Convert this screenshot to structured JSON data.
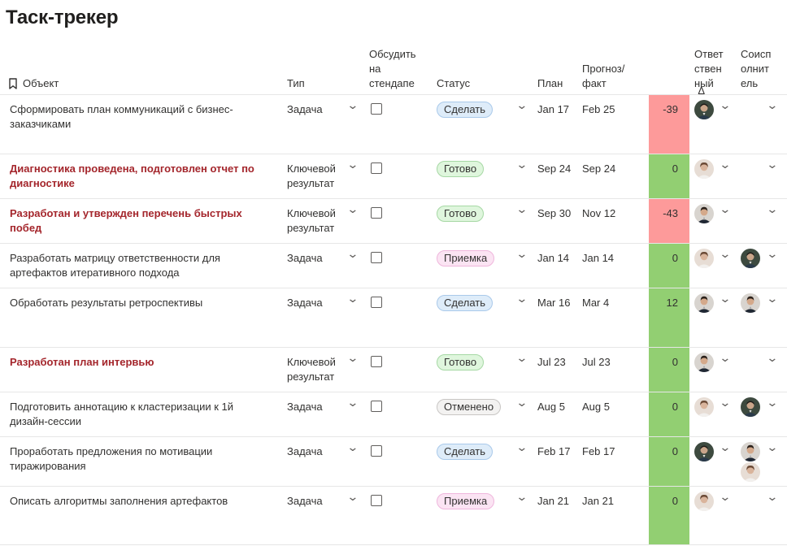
{
  "title": "Таск-трекер",
  "columns": {
    "object": "Объект",
    "type": "Тип",
    "discuss": [
      "Обсудить",
      "на",
      "стендапе"
    ],
    "status": "Статус",
    "plan": "План",
    "forecast": [
      "Прогноз/",
      "факт"
    ],
    "delta": "Δ",
    "responsible": [
      "Ответ",
      "ствен",
      "ный"
    ],
    "coexecutor": [
      "Соисп",
      "олнит",
      "ель"
    ]
  },
  "colors": {
    "negative_delta": "#fd9a9a",
    "positive_delta": "#92cf72",
    "key_result_text": "#a4262c"
  },
  "status_styles": {
    "Сделать": {
      "bg": "#deecf9",
      "border": "#a9c9ea",
      "text": "#323130"
    },
    "Готово": {
      "bg": "#dff6dd",
      "border": "#a6d8a4",
      "text": "#323130"
    },
    "Приемка": {
      "bg": "#fbe4f3",
      "border": "#efb6dc",
      "text": "#323130"
    },
    "Отменено": {
      "bg": "#f3f2f1",
      "border": "#c8c6c4",
      "text": "#323130"
    }
  },
  "rows": [
    {
      "name": [
        "Сформировать план коммуникаций с бизнес-",
        "заказчиками"
      ],
      "key_result": false,
      "type": [
        "Задача"
      ],
      "discuss": false,
      "status": "Сделать",
      "plan": "Jan 17",
      "forecast": "Feb 25",
      "delta": "-39",
      "delta_sign": "neg",
      "responsible": [
        "avatar-dark"
      ],
      "coexecutors": []
    },
    {
      "name": [
        "Диагностика проведена, подготовлен отчет по",
        "диагностике"
      ],
      "key_result": true,
      "type": [
        "Ключевой",
        "результат"
      ],
      "discuss": false,
      "status": "Готово",
      "plan": "Sep 24",
      "forecast": "Sep 24",
      "delta": "0",
      "delta_sign": "pos",
      "responsible": [
        "avatar-light"
      ],
      "coexecutors": []
    },
    {
      "name": [
        "Разработан и утвержден перечень быстрых",
        "побед"
      ],
      "key_result": true,
      "type": [
        "Ключевой",
        "результат"
      ],
      "discuss": false,
      "status": "Готово",
      "plan": "Sep 30",
      "forecast": "Nov 12",
      "delta": "-43",
      "delta_sign": "neg",
      "responsible": [
        "avatar-man"
      ],
      "coexecutors": []
    },
    {
      "name": [
        "Разработать матрицу ответственности для",
        "артефактов итеративного подхода"
      ],
      "key_result": false,
      "type": [
        "Задача"
      ],
      "discuss": false,
      "status": "Приемка",
      "plan": "Jan 14",
      "forecast": "Jan 14",
      "delta": "0",
      "delta_sign": "pos",
      "responsible": [
        "avatar-light"
      ],
      "coexecutors": [
        "avatar-dark"
      ]
    },
    {
      "name": [
        "Обработать результаты ретроспективы"
      ],
      "key_result": false,
      "type": [
        "Задача"
      ],
      "discuss": false,
      "status": "Сделать",
      "plan": "Mar 16",
      "forecast": "Mar 4",
      "delta": "12",
      "delta_sign": "pos",
      "responsible": [
        "avatar-man"
      ],
      "coexecutors": [
        "avatar-man"
      ]
    },
    {
      "name": [
        "Разработан план интервью"
      ],
      "key_result": true,
      "type": [
        "Ключевой",
        "результат"
      ],
      "discuss": false,
      "status": "Готово",
      "plan": "Jul 23",
      "forecast": "Jul 23",
      "delta": "0",
      "delta_sign": "pos",
      "responsible": [
        "avatar-man"
      ],
      "coexecutors": []
    },
    {
      "name": [
        "Подготовить аннотацию к кластеризации к 1й",
        "дизайн-сессии"
      ],
      "key_result": false,
      "type": [
        "Задача"
      ],
      "discuss": false,
      "status": "Отменено",
      "plan": "Aug 5",
      "forecast": "Aug 5",
      "delta": "0",
      "delta_sign": "pos",
      "responsible": [
        "avatar-light"
      ],
      "coexecutors": [
        "avatar-dark"
      ]
    },
    {
      "name": [
        "Проработать предложения по мотивации",
        "тиражирования"
      ],
      "key_result": false,
      "type": [
        "Задача"
      ],
      "discuss": false,
      "status": "Сделать",
      "plan": "Feb 17",
      "forecast": "Feb 17",
      "delta": "0",
      "delta_sign": "pos",
      "responsible": [
        "avatar-dark"
      ],
      "coexecutors": [
        "avatar-man",
        "avatar-light"
      ]
    },
    {
      "name": [
        "Описать алгоритмы заполнения артефактов"
      ],
      "key_result": false,
      "type": [
        "Задача"
      ],
      "discuss": false,
      "status": "Приемка",
      "plan": "Jan 21",
      "forecast": "Jan 21",
      "delta": "0",
      "delta_sign": "pos",
      "responsible": [
        "avatar-light"
      ],
      "coexecutors": []
    }
  ]
}
